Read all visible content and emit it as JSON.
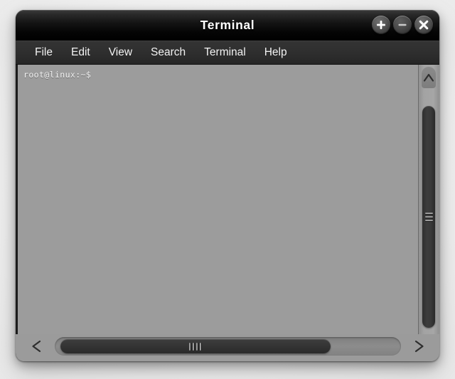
{
  "window": {
    "title": "Terminal",
    "controls": [
      {
        "name": "maximize-button",
        "icon": "plus-icon",
        "label": "+"
      },
      {
        "name": "minimize-button",
        "icon": "minus-icon",
        "label": "−"
      },
      {
        "name": "close-button",
        "icon": "close-icon",
        "label": "×"
      }
    ]
  },
  "menubar": {
    "items": [
      {
        "label": "File"
      },
      {
        "label": "Edit"
      },
      {
        "label": "View"
      },
      {
        "label": "Search"
      },
      {
        "label": "Terminal"
      },
      {
        "label": "Help"
      }
    ]
  },
  "terminal": {
    "prompt": "root@linux:~$",
    "lines": [
      "root@linux:~$"
    ],
    "background_color": "#9c9c9c",
    "text_color": "#f2f2f2"
  },
  "scrollbars": {
    "vertical": {
      "up_arrow_icon": "chevron-up-icon",
      "down_arrow_icon": "chevron-down-icon",
      "thumb_grip_icon": "grip-lines-horizontal-icon"
    },
    "horizontal": {
      "left_arrow_icon": "chevron-left-icon",
      "right_arrow_icon": "chevron-right-icon",
      "thumb_grip_icon": "grip-lines-vertical-icon"
    }
  },
  "colors": {
    "titlebar": "#0a0a0a",
    "menubar": "#2e2e2e",
    "terminal_bg": "#9c9c9c",
    "scrollbar_track": "#8c8c8c",
    "scrollbar_thumb": "#343434"
  }
}
